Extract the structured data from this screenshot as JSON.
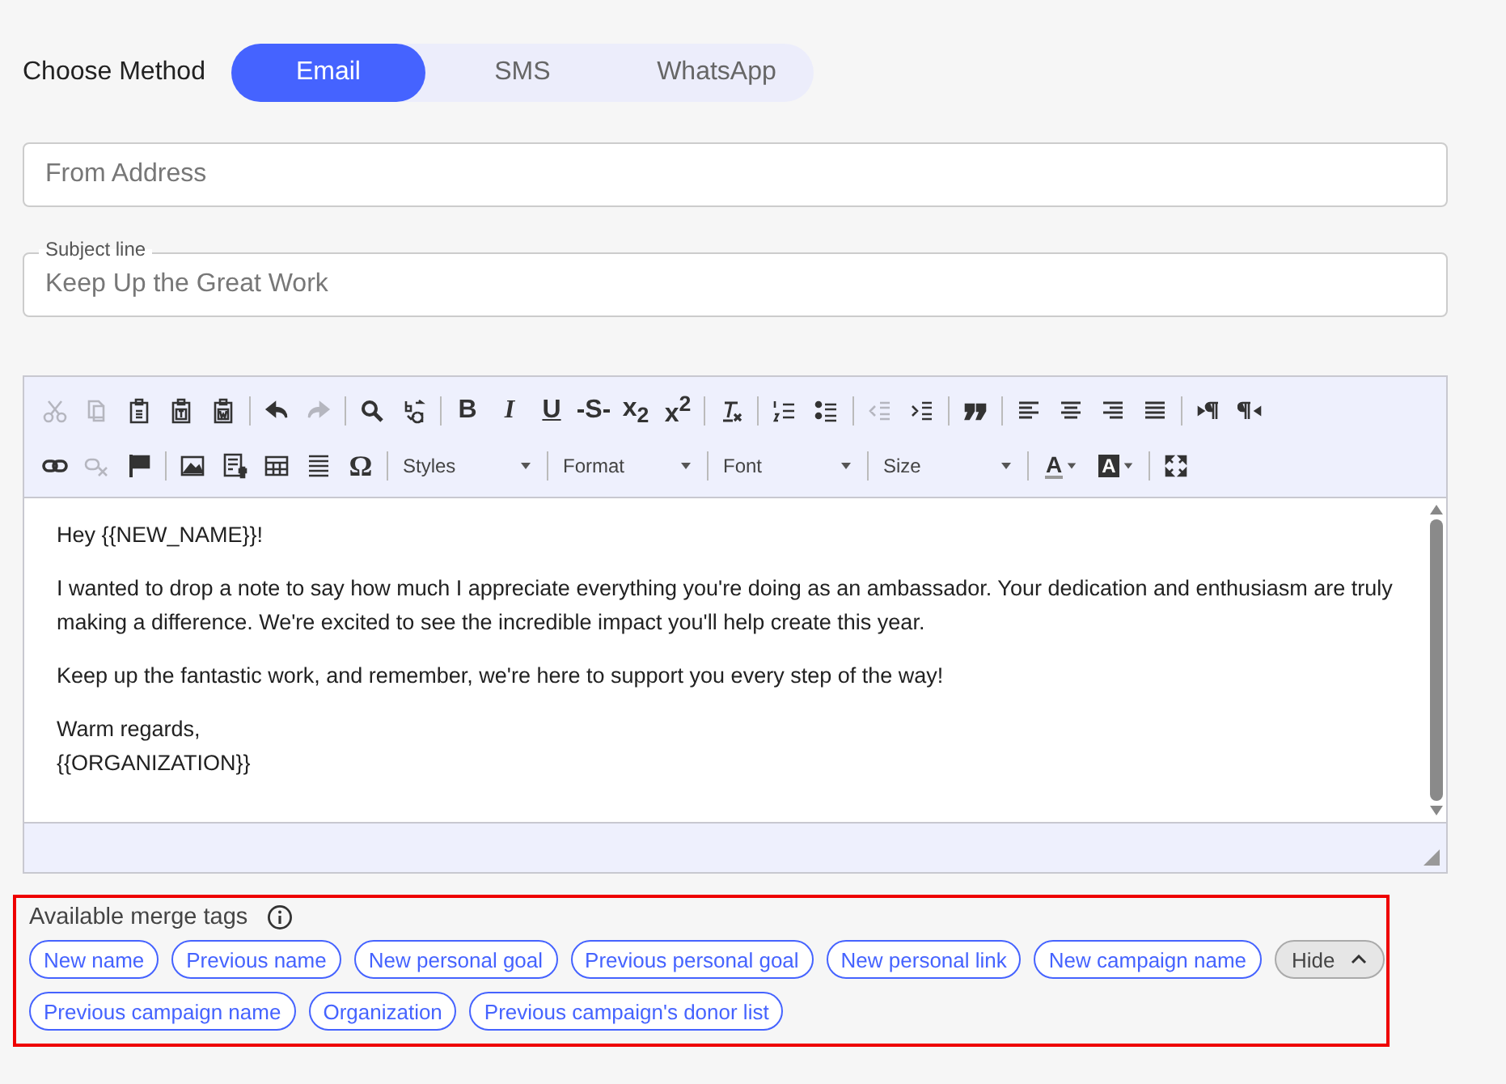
{
  "method": {
    "label": "Choose Method",
    "options": [
      {
        "label": "Email",
        "selected": true
      },
      {
        "label": "SMS",
        "selected": false
      },
      {
        "label": "WhatsApp",
        "selected": false
      }
    ]
  },
  "from_field": {
    "placeholder": "From Address"
  },
  "subject_field": {
    "label": "Subject line",
    "value": "Keep Up the Great Work"
  },
  "editor": {
    "toolbar": [
      [
        [
          {
            "kind": "button",
            "disabled": true
          },
          {
            "kind": "button",
            "disabled": true
          },
          {
            "kind": "button",
            "disabled": false
          },
          {
            "kind": "button",
            "disabled": false
          },
          {
            "kind": "button",
            "disabled": false
          }
        ],
        [
          {
            "kind": "button",
            "disabled": false
          },
          {
            "kind": "button",
            "disabled": true
          }
        ],
        [
          {
            "kind": "button",
            "disabled": false
          },
          {
            "kind": "button",
            "disabled": false
          }
        ],
        [
          {
            "kind": "glyph",
            "glyph": "B",
            "disabled": false
          },
          {
            "kind": "glyph",
            "glyph": "I",
            "disabled": false
          },
          {
            "kind": "glyph",
            "glyph": "U",
            "disabled": false
          },
          {
            "kind": "glyph",
            "glyph": "S",
            "disabled": false
          },
          {
            "kind": "glyph",
            "glyph": "x$_{2}$",
            "disabled": false
          },
          {
            "kind": "glyph",
            "glyph": "x$^{2}$",
            "disabled": false
          }
        ],
        [
          {
            "kind": "button",
            "disabled": false
          }
        ],
        [
          {
            "kind": "button",
            "disabled": false
          },
          {
            "kind": "button",
            "disabled": false
          }
        ],
        [
          {
            "kind": "button",
            "disabled": true
          },
          {
            "kind": "button",
            "disabled": false
          }
        ],
        [
          {
            "kind": "button",
            "disabled": false
          }
        ],
        [
          {
            "kind": "button",
            "disabled": false
          },
          {
            "kind": "button",
            "disabled": false
          },
          {
            "kind": "button",
            "disabled": false
          },
          {
            "kind": "button",
            "disabled": false
          }
        ],
        [
          {
            "kind": "button",
            "disabled": false
          },
          {
            "kind": "button",
            "disabled": false
          }
        ]
      ],
      [
        [
          {
            "kind": "button",
            "disabled": false
          },
          {
            "kind": "button",
            "disabled": true
          },
          {
            "kind": "button",
            "disabled": false
          }
        ],
        [
          {
            "kind": "button",
            "disabled": false
          },
          {
            "kind": "button",
            "disabled": false
          },
          {
            "kind": "button",
            "disabled": false
          },
          {
            "kind": "button",
            "disabled": false
          },
          {
            "kind": "glyph",
            "glyph": "Ω",
            "disabled": false
          }
        ],
        [
          {
            "kind": "dropdown",
            "label": "Styles"
          }
        ],
        [
          {
            "kind": "dropdown",
            "label": "Format"
          }
        ],
        [
          {
            "kind": "dropdown",
            "label": "Font"
          }
        ],
        [
          {
            "kind": "dropdown",
            "label": "Size"
          }
        ],
        [
          {
            "kind": "color",
            "glyph": "A"
          },
          {
            "kind": "color",
            "glyph": "A"
          }
        ],
        [
          {
            "kind": "button",
            "disabled": false
          }
        ]
      ]
    ],
    "body": [
      [
        "Hey {{NEW_NAME}}!"
      ],
      [
        "I wanted to drop a note to say how much I appreciate everything you're doing as an ambassador. Your dedication and enthusiasm are truly making a difference. We're excited to see the incredible impact you'll help create this year."
      ],
      [
        "Keep up the fantastic work, and remember, we're here to support you every step of the way!"
      ],
      [
        "Warm regards,",
        "{{ORGANIZATION}}"
      ]
    ]
  },
  "merge_tags": {
    "title": "Available merge tags",
    "tags": [
      "New name",
      "Previous name",
      "New personal goal",
      "Previous personal goal",
      "New personal link",
      "New campaign name"
    ],
    "hide_button": "Hide",
    "more_tags": [
      "Previous campaign name",
      "Organization",
      "Previous campaign's donor list"
    ]
  }
}
